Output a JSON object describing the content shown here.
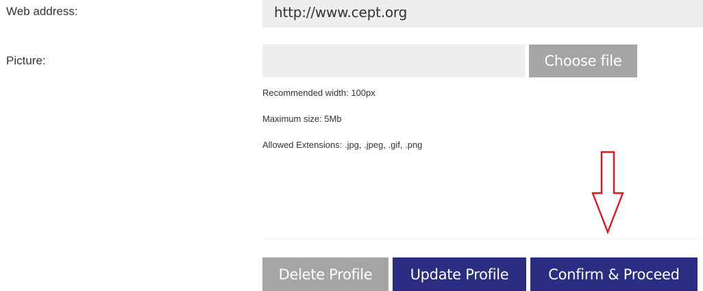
{
  "form": {
    "web_address_label": "Web address:",
    "web_address_value": "http://www.cept.org",
    "picture_label": "Picture:",
    "picture_value": "",
    "choose_file_label": "Choose file",
    "hints": {
      "recommended_width": "Recommended width: 100px",
      "maximum_size": "Maximum size: 5Mb",
      "allowed_extensions": "Allowed Extensions: .jpg, .jpeg, .gif, .png"
    }
  },
  "actions": {
    "delete_label": "Delete Profile",
    "update_label": "Update Profile",
    "confirm_label": "Confirm & Proceed"
  },
  "annotation": {
    "arrow_color": "#e8121a",
    "arrow_icon": "down-arrow-icon"
  },
  "colors": {
    "primary_button": "#2b2e83",
    "secondary_button": "#a5a5a5",
    "field_background": "#eeeeee"
  }
}
